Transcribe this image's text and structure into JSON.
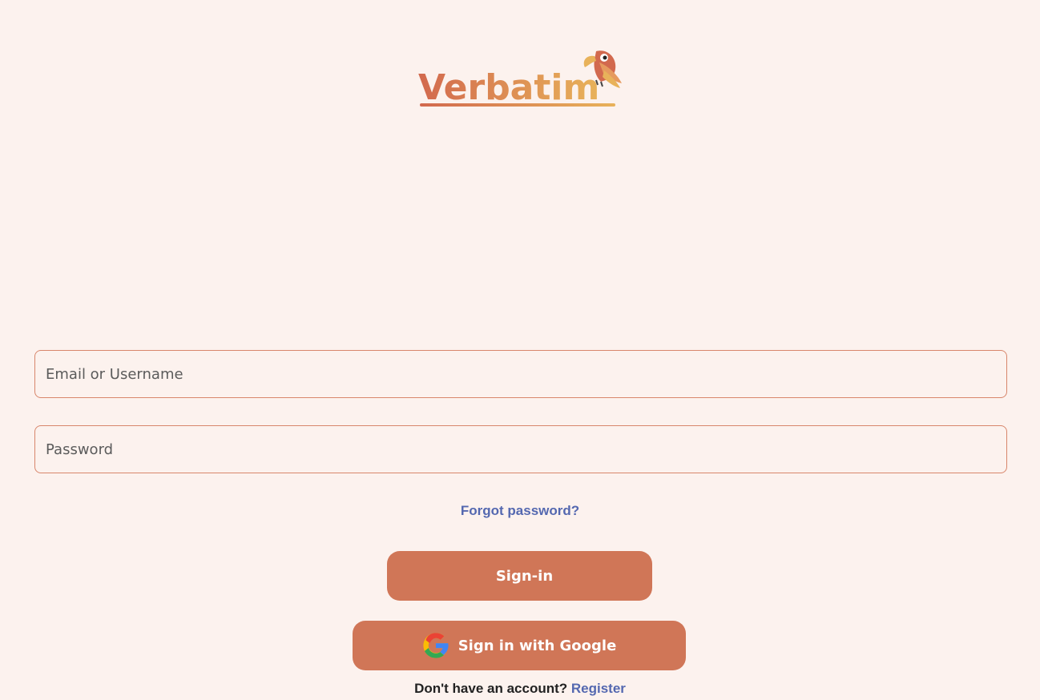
{
  "brand": {
    "name": "Verbatim",
    "logo_icon": "parrot-logo-icon",
    "colors": {
      "gradient_start": "#d2694e",
      "gradient_end": "#e8b25a"
    }
  },
  "form": {
    "email_placeholder": "Email or Username",
    "email_value": "",
    "password_placeholder": "Password",
    "password_value": "",
    "forgot_password_label": "Forgot password?"
  },
  "actions": {
    "signin_label": "Sign-in",
    "google_label": "Sign in with Google",
    "google_icon": "google-icon"
  },
  "footer": {
    "no_account_text": "Don't have an account?",
    "register_label": "Register"
  },
  "theme": {
    "background": "#fcf2ee",
    "accent": "#d07657",
    "link": "#5468b0",
    "field_border": "#d8866b"
  }
}
